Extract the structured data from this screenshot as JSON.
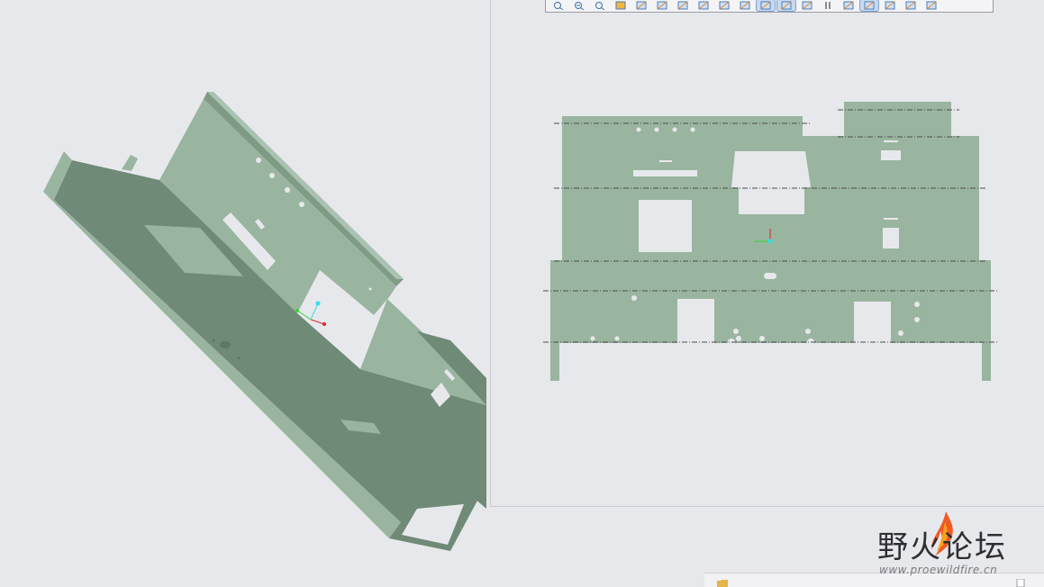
{
  "viewport3d": {
    "label": "3D model view"
  },
  "drawing": {
    "toolbar": {
      "buttons": [
        {
          "icon": "zoom-fit-icon"
        },
        {
          "icon": "zoom-in-icon"
        },
        {
          "icon": "zoom-out-icon"
        },
        {
          "icon": "repaint-icon"
        },
        {
          "icon": "view-manager-icon"
        },
        {
          "icon": "saved-orientations-icon"
        },
        {
          "icon": "named-views-icon"
        },
        {
          "icon": "display-style-icon"
        },
        {
          "icon": "perspective-icon"
        },
        {
          "icon": "spin-center-icon"
        },
        {
          "icon": "show-hidden-icon",
          "active": true
        },
        {
          "icon": "datum-display-icon",
          "active": true
        },
        {
          "icon": "annotation-display-icon"
        },
        {
          "icon": "pause-icon"
        },
        {
          "icon": "datum-planes-icon"
        },
        {
          "icon": "datum-axes-icon",
          "active": true
        },
        {
          "icon": "datum-points-icon"
        },
        {
          "icon": "csys-display-icon"
        },
        {
          "icon": "layers-icon"
        }
      ]
    }
  },
  "colors": {
    "sheet_face": "#99b59f",
    "sheet_dark": "#6f8a76",
    "background": "#e7e8ec",
    "axis_red": "#e0232a",
    "axis_green": "#37d33b",
    "axis_cyan": "#2fe0e8"
  },
  "watermark": {
    "title": "野火论坛",
    "url": "www.proewildfire.cn"
  }
}
